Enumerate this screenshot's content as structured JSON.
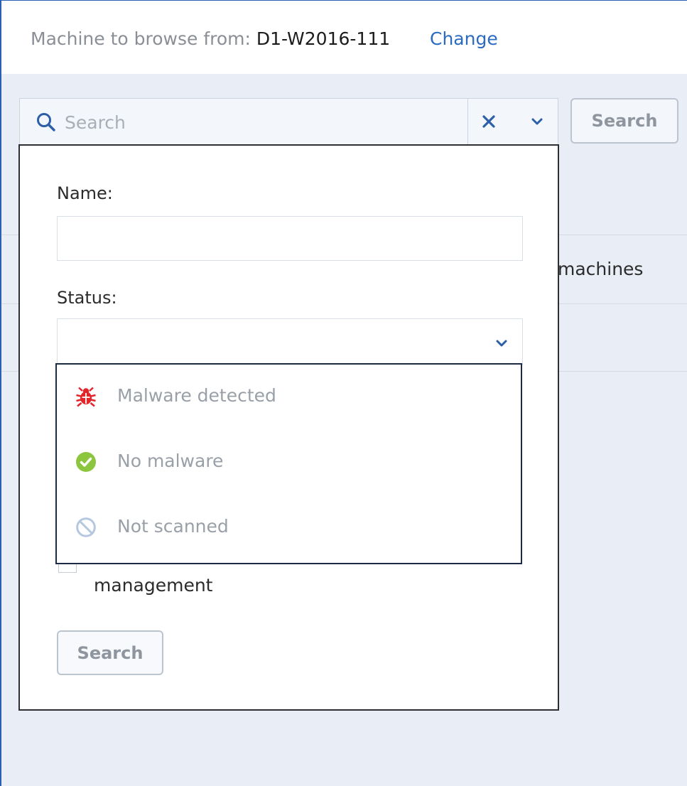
{
  "header": {
    "machine_label": "Machine to browse from:",
    "machine_name": "D1-W2016-111",
    "change_link": "Change"
  },
  "search_bar": {
    "placeholder": "Search",
    "icons": [
      "search-icon",
      "close-icon",
      "chevron-down-icon"
    ],
    "search_button": "Search"
  },
  "background_list": {
    "visible_text": "machines"
  },
  "filter_panel": {
    "name_label": "Name:",
    "name_value": "",
    "status_label": "Status:",
    "status_value": "",
    "status_options": [
      {
        "label": "Malware detected",
        "icon": "bug-icon",
        "color": "#e3242b"
      },
      {
        "label": "No malware",
        "icon": "check-circle-icon",
        "color": "#8cc63f"
      },
      {
        "label": "Not scanned",
        "icon": "prohibited-icon",
        "color": "#b6c7e0"
      }
    ],
    "checkbox_label_visible": "management",
    "checkbox_checked": false,
    "search_button": "Search"
  },
  "colors": {
    "accent": "#2c6bbf",
    "background": "#e8edf6",
    "panel_border": "#2d2f33",
    "dropdown_border": "#1d2a47"
  }
}
